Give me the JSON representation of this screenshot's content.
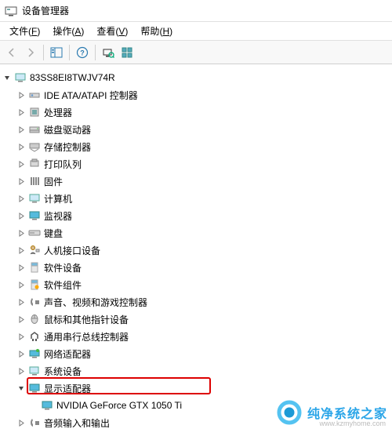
{
  "window": {
    "title": "设备管理器"
  },
  "menu": {
    "file": {
      "label": "文件",
      "hotkey": "F"
    },
    "action": {
      "label": "操作",
      "hotkey": "A"
    },
    "view": {
      "label": "查看",
      "hotkey": "V"
    },
    "help": {
      "label": "帮助",
      "hotkey": "H"
    }
  },
  "tree": {
    "root": "83SS8EI8TWJV74R",
    "items": [
      {
        "label": "IDE ATA/ATAPI 控制器",
        "expanded": false
      },
      {
        "label": "处理器",
        "expanded": false
      },
      {
        "label": "磁盘驱动器",
        "expanded": false
      },
      {
        "label": "存储控制器",
        "expanded": false
      },
      {
        "label": "打印队列",
        "expanded": false
      },
      {
        "label": "固件",
        "expanded": false
      },
      {
        "label": "计算机",
        "expanded": false
      },
      {
        "label": "监视器",
        "expanded": false
      },
      {
        "label": "键盘",
        "expanded": false
      },
      {
        "label": "人机接口设备",
        "expanded": false
      },
      {
        "label": "软件设备",
        "expanded": false
      },
      {
        "label": "软件组件",
        "expanded": false
      },
      {
        "label": "声音、视频和游戏控制器",
        "expanded": false
      },
      {
        "label": "鼠标和其他指针设备",
        "expanded": false
      },
      {
        "label": "通用串行总线控制器",
        "expanded": false
      },
      {
        "label": "网络适配器",
        "expanded": false
      },
      {
        "label": "系统设备",
        "expanded": false
      },
      {
        "label": "显示适配器",
        "expanded": true,
        "children": [
          {
            "label": "NVIDIA GeForce GTX 1050 Ti"
          }
        ]
      },
      {
        "label": "音频输入和输出",
        "expanded": false
      }
    ]
  },
  "watermark": {
    "text": "纯净系统之家",
    "url": "www.kzmyhome.com"
  }
}
